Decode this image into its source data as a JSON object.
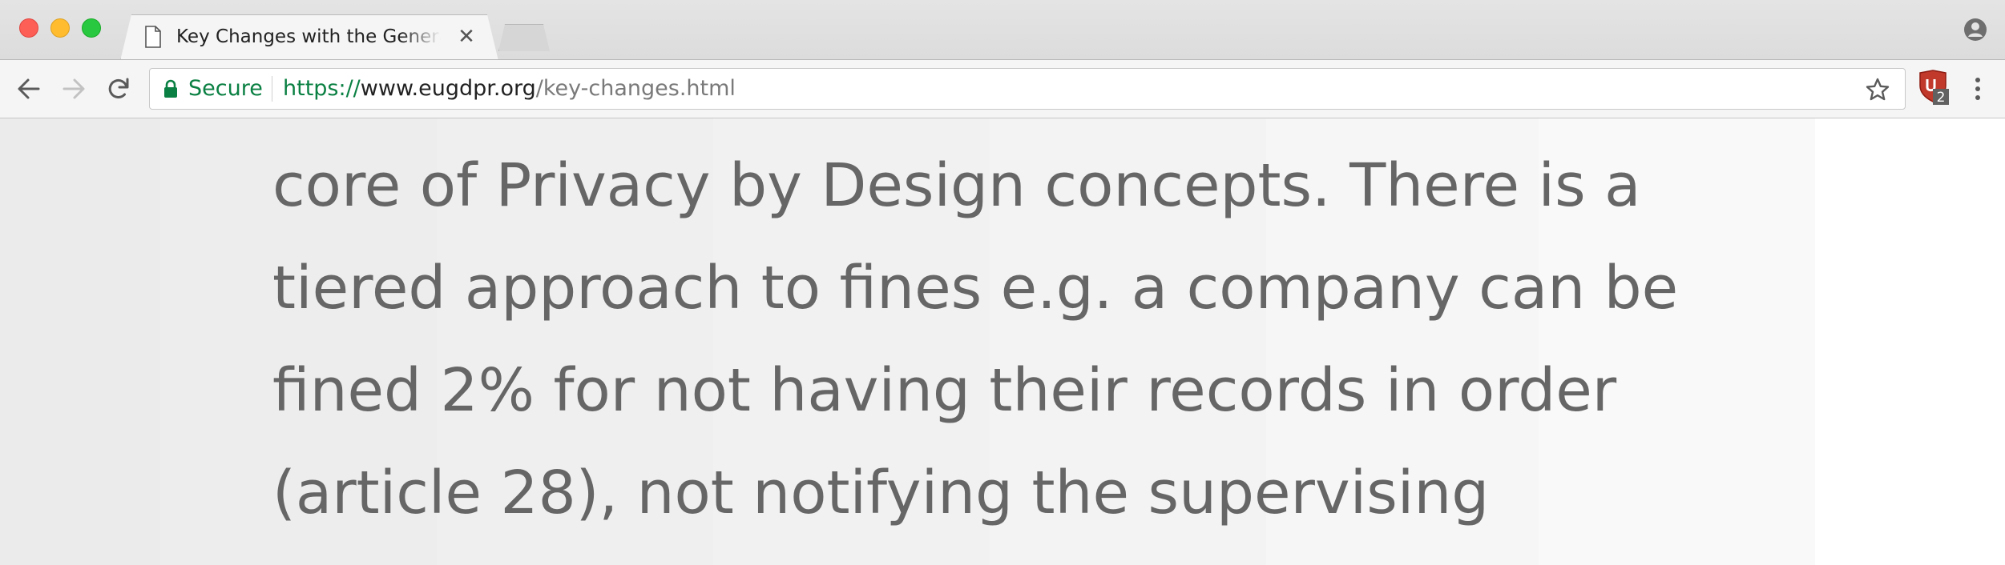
{
  "tab": {
    "title": "Key Changes with the General Data Protection Regulation",
    "close_glyph": "✕"
  },
  "toolbar": {
    "secure_label": "Secure",
    "url_scheme": "https://",
    "url_host": "www.eugdpr.org",
    "url_path": "/key-changes.html"
  },
  "extension": {
    "badge": "2"
  },
  "article": {
    "lines": [
      "core of Privacy by Design concepts. There is a",
      "tiered approach to fines e.g. a company can be",
      "fined 2% for not having their records in order",
      "(article 28), not notifying the supervising"
    ]
  },
  "colors": {
    "secure_green": "#0b8043",
    "body_text": "#666666",
    "close_light": "#fd5f57",
    "minimize_light": "#febc2e",
    "maximize_light": "#28c840",
    "extension_red": "#c0392b"
  },
  "icons": {
    "tab": "document-icon",
    "back": "arrow-left-icon",
    "forward": "arrow-right-icon",
    "reload": "reload-icon",
    "lock": "lock-icon",
    "bookmark": "star-icon",
    "extension": "ublock-shield-icon",
    "menu": "kebab-menu-icon",
    "profile": "person-icon"
  }
}
